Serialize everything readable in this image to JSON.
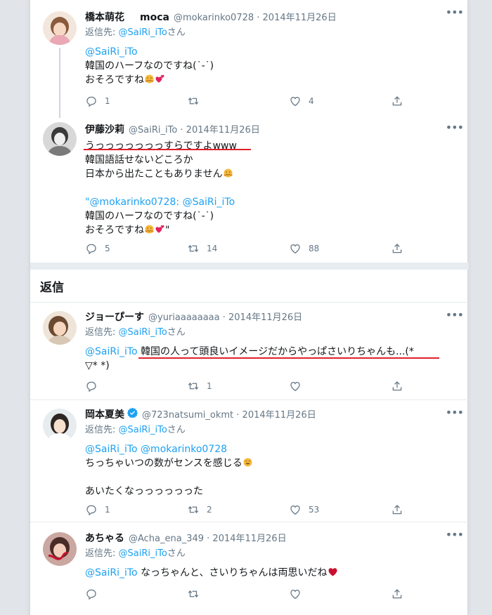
{
  "section_title": "返信",
  "icons": {
    "reply": "reply-icon",
    "retweet": "retweet-icon",
    "like": "heart-icon",
    "share": "share-icon",
    "more": "more-icon"
  },
  "colors": {
    "link": "#1da1f2",
    "underline": "#e0202a",
    "muted": "#657786"
  },
  "more_glyph": "•••",
  "tweets": [
    {
      "name": "橋本萌花",
      "name_extra": "moca",
      "handle": "@mokarinko0728 · 2014年11月26日",
      "replying_prefix": "返信先: ",
      "replying_handle": "@SaiRi_iTo",
      "replying_suffix": "さん",
      "lines": [
        "@SaiRi_iTo",
        "韓国のハーフなのですね(˙-˙)",
        "おそろですね"
      ],
      "reply_count": "1",
      "retweet_count": "",
      "like_count": "4"
    },
    {
      "name": "伊藤沙莉",
      "handle": "@SaiRi_iTo · 2014年11月26日",
      "lines": [
        "うっっっっっっっすらですよwww",
        "韓国語話せないどころか",
        "日本から出たこともありません",
        "",
        "\"@mokarinko0728: @SaiRi_iTo",
        "韓国のハーフなのですね(˙-˙)",
        "おそろですね"
      ],
      "quote_suffix": "\"",
      "reply_count": "5",
      "retweet_count": "14",
      "like_count": "88"
    },
    {
      "name": "ジョーぴーす",
      "handle": "@yuriaaaaaaaa · 2014年11月26日",
      "replying_prefix": "返信先: ",
      "replying_handle": "@SaiRi_iTo",
      "replying_suffix": "さん",
      "mention": "@SaiRi_iTo",
      "text": "韓国の人って頭良いイメージだからやっぱさいりちゃんも...(*",
      "text_line2": "▽* *)",
      "reply_count": "",
      "retweet_count": "1",
      "like_count": ""
    },
    {
      "name": "岡本夏美",
      "handle": "@723natsumi_okmt · 2014年11月26日",
      "replying_prefix": "返信先: ",
      "replying_handle": "@SaiRi_iTo",
      "replying_suffix": "さん",
      "lines": [
        "@SaiRi_iTo @mokarinko0728",
        "ちっちゃいつの数がセンスを感じる",
        "",
        "あいたくなっっっっっった"
      ],
      "reply_count": "1",
      "retweet_count": "2",
      "like_count": "53"
    },
    {
      "name": "あちゃる",
      "handle": "@Acha_ena_349 · 2014年11月26日",
      "replying_prefix": "返信先: ",
      "replying_handle": "@SaiRi_iTo",
      "replying_suffix": "さん",
      "mention": "@SaiRi_iTo",
      "text": "なっちゃんと、さいりちゃんは両思いだね",
      "reply_count": "",
      "retweet_count": "",
      "like_count": ""
    }
  ]
}
